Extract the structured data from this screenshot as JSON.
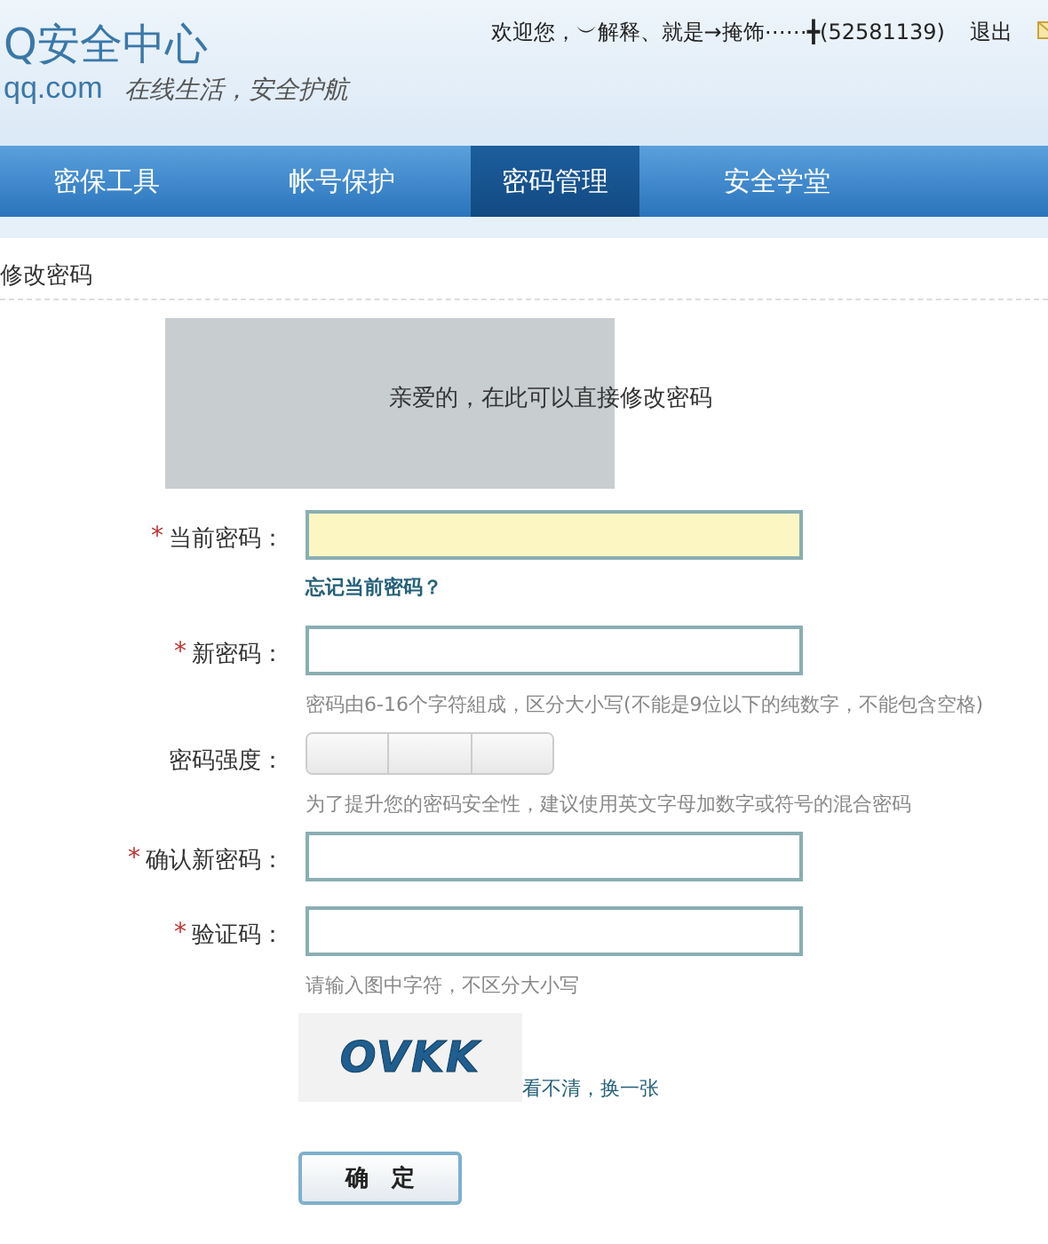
{
  "header": {
    "logo": "Q安全中心",
    "domain": "qq.com",
    "slogan": "在线生活，安全护航",
    "welcome": "欢迎您，︶解释、就是→掩饰⋯⋯╋(52581139)",
    "logout": "退出"
  },
  "tabs": [
    {
      "label": "密保工具",
      "selected": false
    },
    {
      "label": "帐号保护",
      "selected": false
    },
    {
      "label": "密码管理",
      "selected": true
    },
    {
      "label": "安全学堂",
      "selected": false
    }
  ],
  "section_title": "修改密码",
  "notice": "亲爱的，在此可以直接修改密码",
  "form": [
    {
      "kind": "field",
      "label": "当前密码：",
      "required_mark": "*",
      "focused": true,
      "link": "忘记当前密码？"
    },
    {
      "kind": "field",
      "label": "新密码：",
      "required_mark": "*",
      "focused": false,
      "hint": "密码由6-16个字符組成，区分大小写(不能是9位以下的纯数字，不能包含空格)"
    },
    {
      "kind": "strength",
      "label": "密码强度：",
      "hint": "为了提升您的密码安全性，建议使用英文字母加数字或符号的混合密码"
    },
    {
      "kind": "field",
      "label": "确认新密码：",
      "required_mark": "*",
      "focused": false
    },
    {
      "kind": "field",
      "label": "验证码：",
      "required_mark": "*",
      "focused": false,
      "hint": "请输入图中字符，不区分大小写"
    }
  ],
  "captcha": {
    "text": "OVKK",
    "refresh": "看不清，换一张"
  },
  "submit": "确　定"
}
